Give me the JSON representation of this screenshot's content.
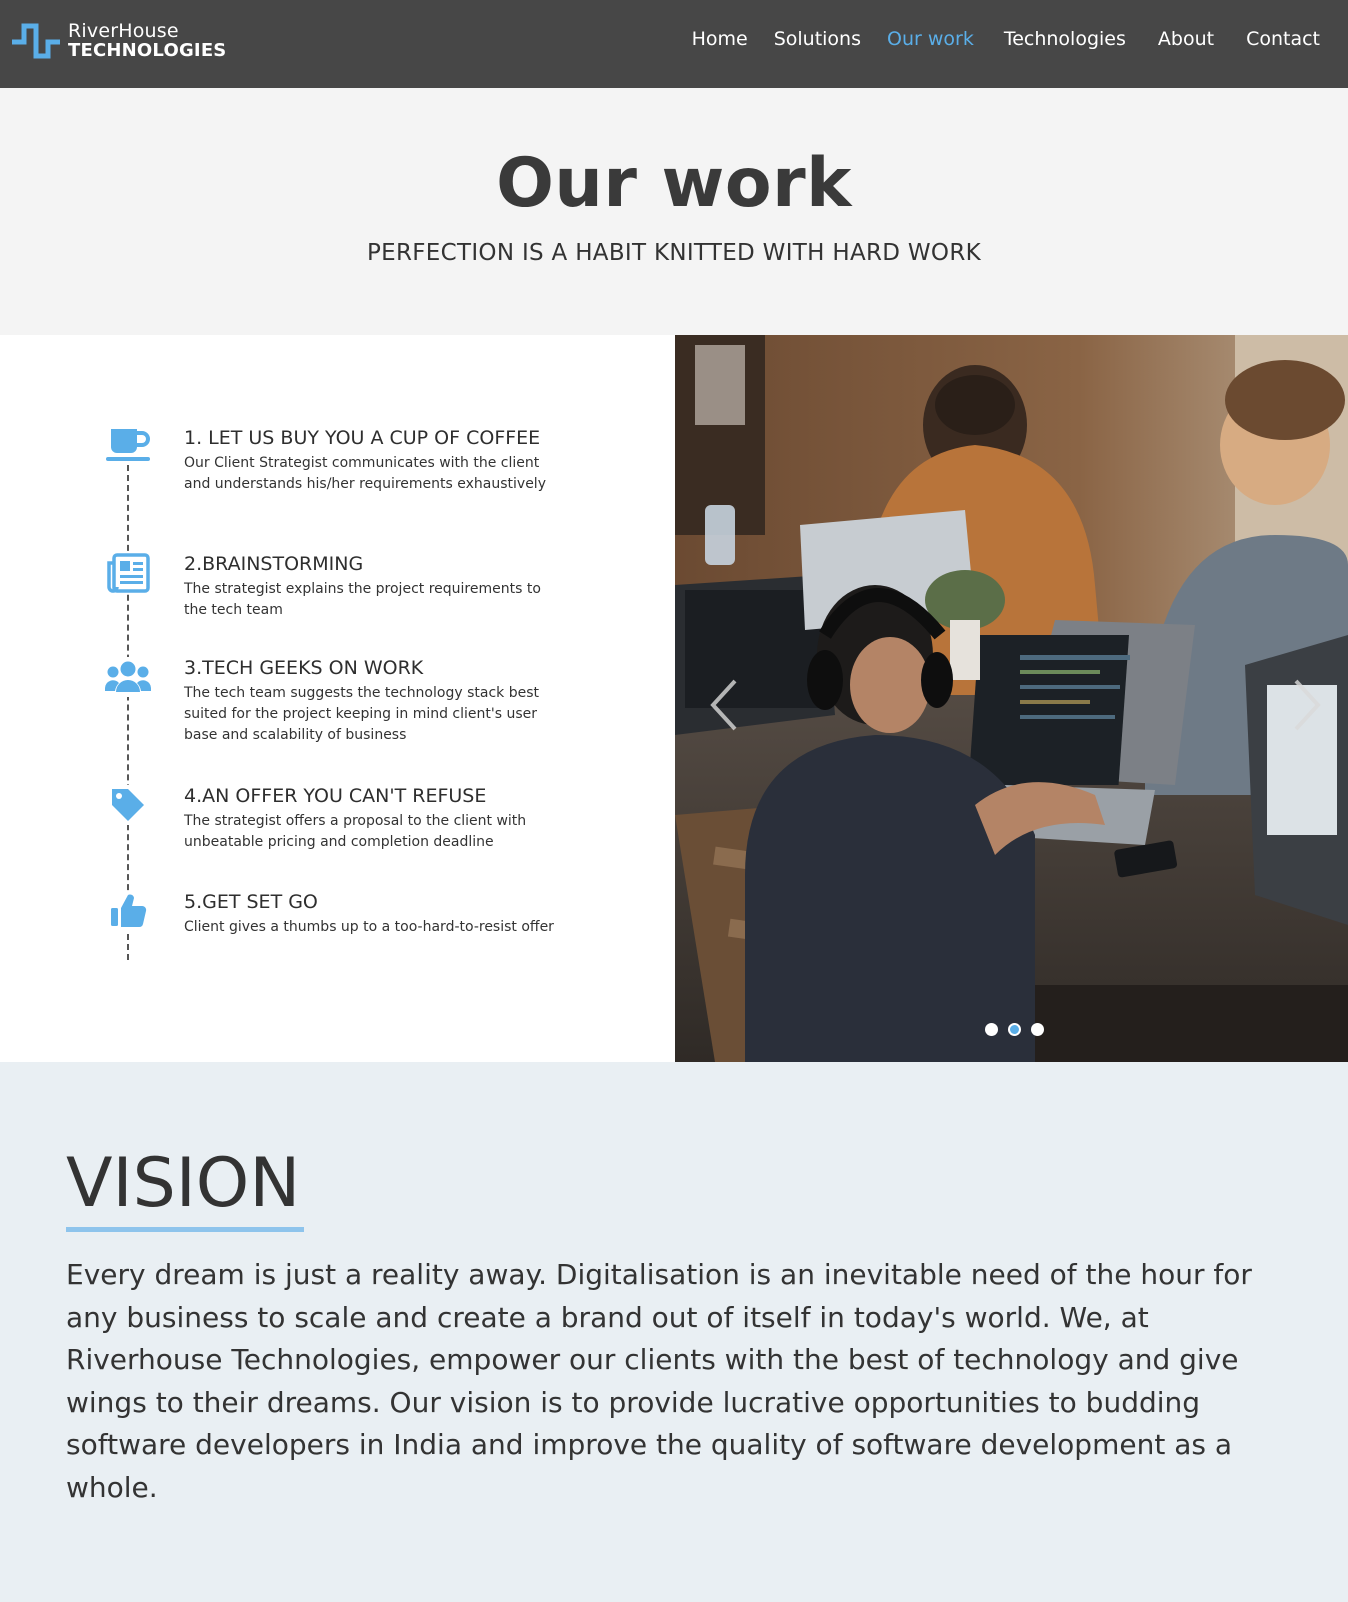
{
  "brand": {
    "name_line1": "RiverHouse",
    "name_line2": "TECHNOLOGIES",
    "accent_color": "#5aaee8"
  },
  "nav": {
    "items": [
      {
        "label": "Home",
        "active": false
      },
      {
        "label": "Solutions",
        "active": false
      },
      {
        "label": "Our work",
        "active": true
      },
      {
        "label": "Technologies",
        "active": false
      },
      {
        "label": "About",
        "active": false
      },
      {
        "label": "Contact",
        "active": false
      }
    ]
  },
  "hero": {
    "title": "Our work",
    "subtitle": "PERFECTION IS A HABIT KNITTED WITH HARD WORK"
  },
  "process": {
    "steps": [
      {
        "icon": "coffee-cup-icon",
        "title": "1. LET US BUY YOU A CUP OF COFFEE",
        "description": "Our Client Strategist communicates with the client and understands his/her requirements exhaustively"
      },
      {
        "icon": "newspaper-icon",
        "title": "2.BRAINSTORMING",
        "description": "The strategist explains the project requirements to the tech team"
      },
      {
        "icon": "users-icon",
        "title": "3.TECH GEEKS ON WORK",
        "description": "The tech team suggests the technology stack best suited for the project keeping in mind client's user base and scalability of business"
      },
      {
        "icon": "tag-icon",
        "title": "4.AN OFFER YOU CAN'T REFUSE",
        "description": "The strategist offers a proposal to the client with unbeatable pricing and completion deadline"
      },
      {
        "icon": "thumbs-up-icon",
        "title": "5.GET SET GO",
        "description": "Client gives a thumbs up to a too-hard-to-resist offer"
      }
    ]
  },
  "carousel": {
    "slide_count": 3,
    "active_slide": 2,
    "prev_icon": "chevron-left-icon",
    "next_icon": "chevron-right-icon"
  },
  "vision": {
    "title": "VISION",
    "text": "Every dream is just a reality away. Digitalisation is an inevitable need of the hour for any business to scale and create a brand out of itself in today's world. We, at Riverhouse Technologies, empower our clients with the best of technology and give wings to their dreams. Our vision is to provide lucrative opportunities to budding software developers in India and improve the quality of software development as a whole."
  }
}
